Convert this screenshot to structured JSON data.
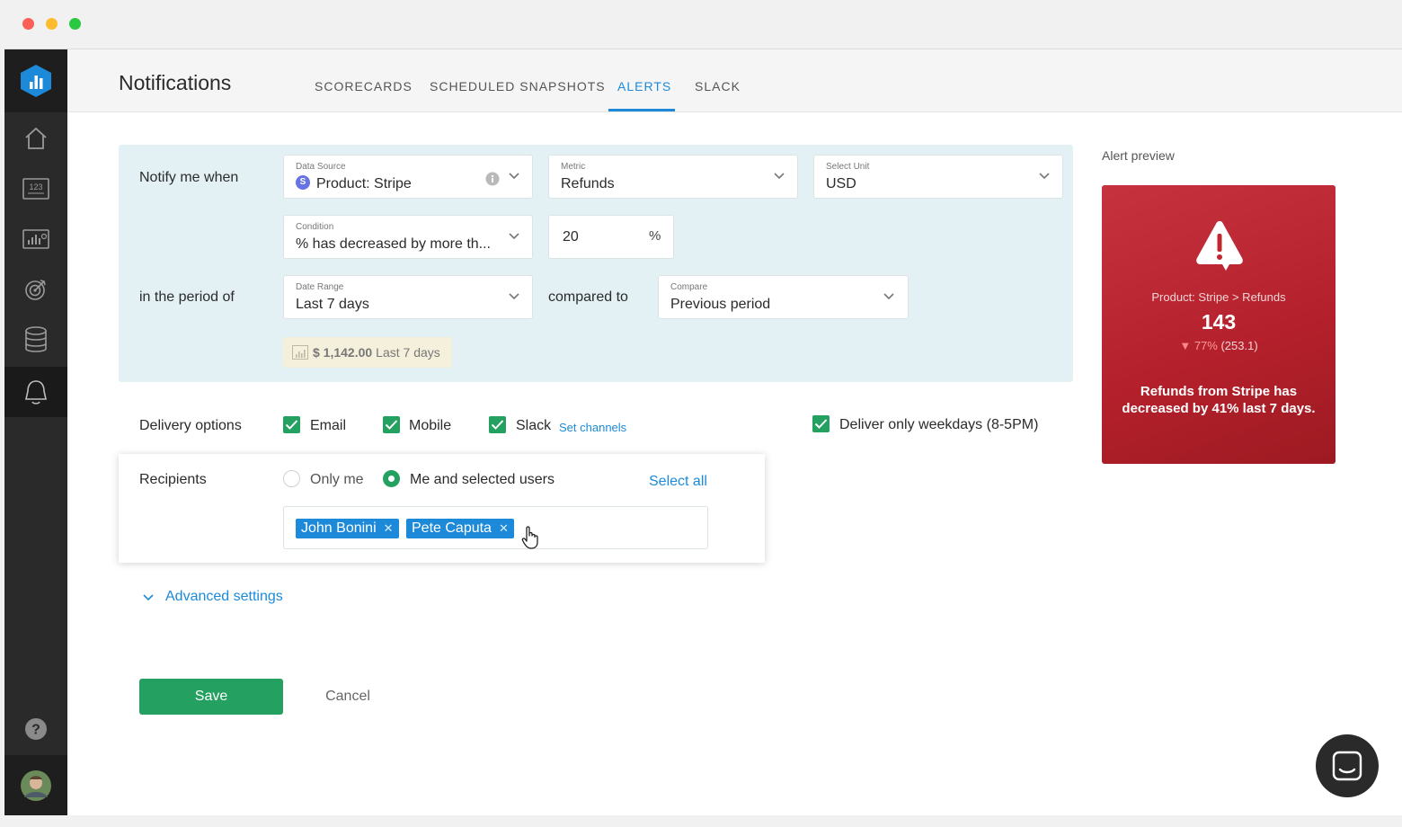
{
  "header": {
    "title": "Notifications",
    "tabs": [
      {
        "label": "SCORECARDS",
        "active": false
      },
      {
        "label": "SCHEDULED SNAPSHOTS",
        "active": false
      },
      {
        "label": "ALERTS",
        "active": true
      },
      {
        "label": "SLACK",
        "active": false
      }
    ]
  },
  "sidebar": {
    "items": [
      {
        "icon": "home-icon"
      },
      {
        "icon": "number-metrics-icon",
        "text": "123"
      },
      {
        "icon": "dashboard-chart-icon"
      },
      {
        "icon": "goals-target-icon"
      },
      {
        "icon": "database-icon"
      },
      {
        "icon": "bell-icon",
        "active": true
      }
    ],
    "help_icon": "help-icon",
    "avatar": "user-avatar"
  },
  "config": {
    "notify_label": "Notify me when",
    "period_label": "in the period of",
    "compared_label": "compared to",
    "data_source": {
      "label": "Data Source",
      "value": "Product: Stripe",
      "badge": "S"
    },
    "metric": {
      "label": "Metric",
      "value": "Refunds"
    },
    "unit": {
      "label": "Select Unit",
      "value": "USD"
    },
    "condition": {
      "label": "Condition",
      "value": "% has decreased by more th..."
    },
    "threshold": {
      "value": "20",
      "suffix": "%"
    },
    "date_range": {
      "label": "Date Range",
      "value": "Last 7 days"
    },
    "compare": {
      "label": "Compare",
      "value": "Previous period"
    },
    "hint": {
      "amount": "$ 1,142.00",
      "period": "Last 7 days"
    }
  },
  "delivery": {
    "label": "Delivery options",
    "email": "Email",
    "mobile": "Mobile",
    "slack": "Slack",
    "set_channels": "Set channels",
    "weekdays": "Deliver only weekdays (8-5PM)"
  },
  "recipients": {
    "label": "Recipients",
    "only_me": "Only me",
    "me_and_selected": "Me and selected users",
    "select_all": "Select all",
    "users": [
      "John Bonini",
      "Pete Caputa"
    ]
  },
  "advanced": "Advanced settings",
  "actions": {
    "save": "Save",
    "cancel": "Cancel"
  },
  "preview": {
    "label": "Alert preview",
    "source": "Product: Stripe > Refunds",
    "value": "143",
    "delta_pct": "77%",
    "delta_prev": "(253.1)",
    "message": "Refunds from Stripe has decreased by 41% last 7 days."
  },
  "colors": {
    "accent": "#1c8ad9",
    "success": "#24a160",
    "alert": "#b3202b",
    "sidebar": "#2a2a2a"
  }
}
